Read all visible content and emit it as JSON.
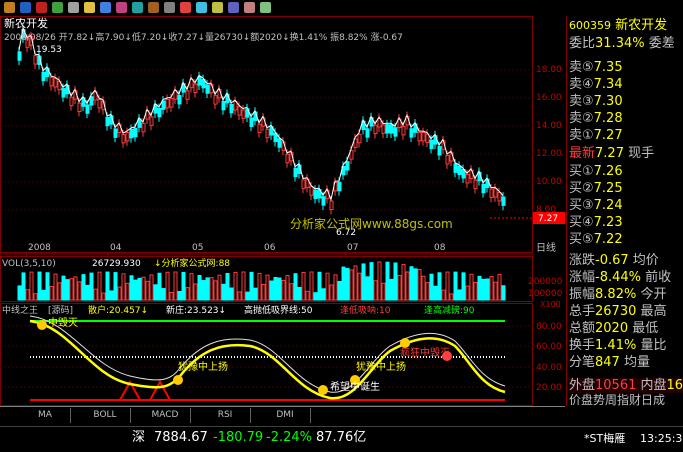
{
  "title": "新农开发",
  "info_line": "2008/08/26 开7.82↓高7.90↓低7.20↓收7.27↓量26730↓额2020↓换1.41% 振8.82% 涨-0.67",
  "high_label": "19.53",
  "low_label": "6.72",
  "price_axis": [
    "18.00",
    "16.00",
    "14.00",
    "12.00",
    "10.00",
    "8.00"
  ],
  "current_price_tag": "7.27",
  "date_axis": [
    "2008",
    "04",
    "05",
    "06",
    "07",
    "08"
  ],
  "date_axis_end": "日线",
  "watermark": "分析家公式网www.88gs.com",
  "vol_label": "VOL(3,5,10)",
  "vol_value": "26729.930",
  "vol_extra": "↓分析家公式网:88",
  "vol_axis": [
    "200000",
    "100000"
  ],
  "vol_unit": "X100",
  "ind_title": "中线之王",
  "ind_src": "[源码]",
  "ind_retail": "散户:20.457↓",
  "ind_new": "新庄:23.523↓",
  "ind_line": "高抛低吸界线:50",
  "ind_low": "逢低吸呐:10",
  "ind_high": "逢高减磅:90",
  "ind_axis": [
    "80.00",
    "60.00",
    "40.00",
    "20.00"
  ],
  "annot": {
    "a1": "中毁灭",
    "a2": "犹豫中上扬",
    "a3": "犹豫中上扬",
    "a4": "希望中诞生",
    "a5": "疯狂中毁灭"
  },
  "tabs": [
    "MA",
    "BOLL",
    "MACD",
    "RSI",
    "DMI"
  ],
  "status": {
    "market": "深",
    "index": "7884.67",
    "chg": "-180.79",
    "pct": "-2.24%",
    "amt": "87.76亿",
    "stock": "*ST梅雁",
    "time": "13:25:3"
  },
  "panel": {
    "code": "600359",
    "name": "新农开发",
    "weibi": "委比",
    "weibi_val": "31.34%",
    "weicha": "委差",
    "sells": [
      {
        "l": "卖⑤",
        "v": "7.35"
      },
      {
        "l": "卖④",
        "v": "7.34"
      },
      {
        "l": "卖③",
        "v": "7.30"
      },
      {
        "l": "卖②",
        "v": "7.28"
      },
      {
        "l": "卖①",
        "v": "7.27"
      }
    ],
    "latest": "最新",
    "latest_val": "7.27",
    "xianshou": "现手",
    "buys": [
      {
        "l": "买①",
        "v": "7.26"
      },
      {
        "l": "买②",
        "v": "7.25"
      },
      {
        "l": "买③",
        "v": "7.24"
      },
      {
        "l": "买④",
        "v": "7.23"
      },
      {
        "l": "买⑤",
        "v": "7.22"
      }
    ],
    "stats": [
      {
        "a": "涨跌",
        "b": "-0.67",
        "c": "均价"
      },
      {
        "a": "涨幅",
        "b": "-8.44%",
        "c": "前收"
      },
      {
        "a": "振幅",
        "b": "8.82%",
        "c": "今开"
      },
      {
        "a": "总手",
        "b": "26730",
        "c": "最高"
      },
      {
        "a": "总额",
        "b": "2020",
        "c": "最低"
      },
      {
        "a": "换手",
        "b": "1.41%",
        "c": "量比"
      },
      {
        "a": "分笔",
        "b": "847",
        "c": "均量"
      }
    ],
    "outer": "外盘",
    "outer_val": "10561",
    "inner": "内盘",
    "inner_val": "16",
    "footer": "价盘势周指财日成"
  },
  "colors": {
    "candle_up": "#ff3c3c",
    "candle_down": "#00ffff",
    "ma": "#ffffff",
    "ind_line1": "#ffff00",
    "ind_line2": "#e0e0e0"
  }
}
